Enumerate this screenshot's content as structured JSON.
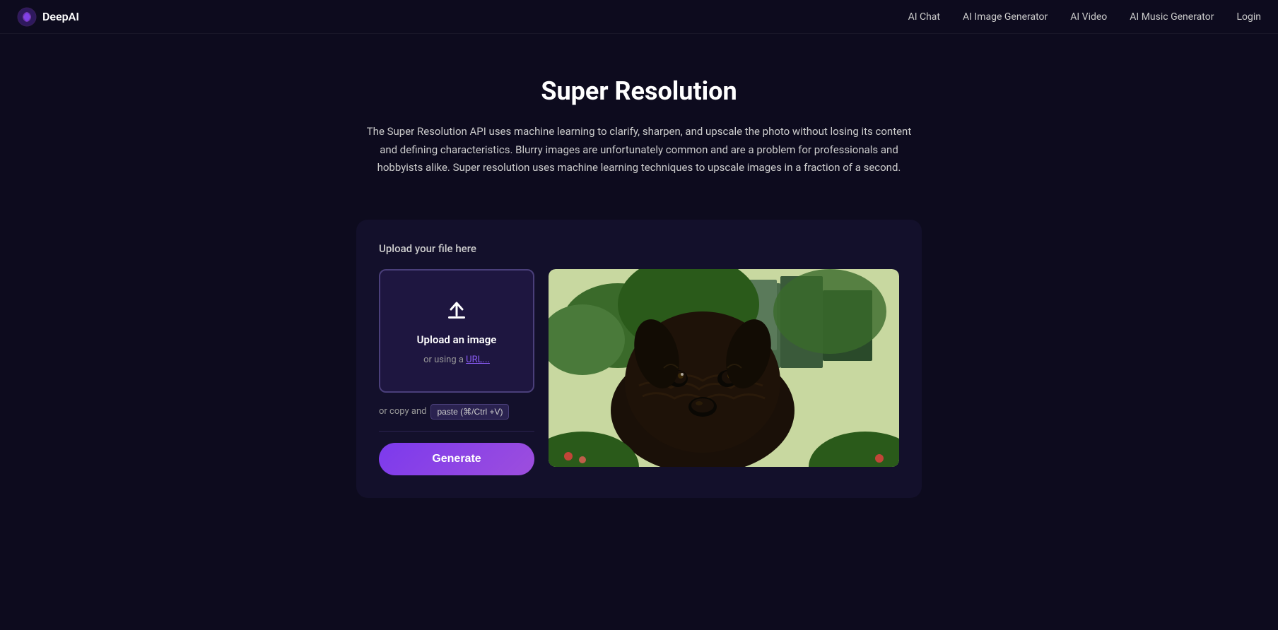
{
  "brand": {
    "name": "DeepAI",
    "logo_alt": "DeepAI Logo"
  },
  "navbar": {
    "links": [
      {
        "id": "ai-chat",
        "label": "AI Chat",
        "href": "#"
      },
      {
        "id": "ai-image-generator",
        "label": "AI Image Generator",
        "href": "#"
      },
      {
        "id": "ai-video",
        "label": "AI Video",
        "href": "#"
      },
      {
        "id": "ai-music-generator",
        "label": "AI Music Generator",
        "href": "#"
      }
    ],
    "login_label": "Login"
  },
  "hero": {
    "title": "Super Resolution",
    "description": "The Super Resolution API uses machine learning  to clarify, sharpen, and upscale the photo without losing its content and defining characteristics. Blurry images are unfortunately common and are a problem for professionals and hobbyists alike. Super resolution uses machine learning techniques to upscale images in a fraction of a second."
  },
  "upload_section": {
    "title": "Upload your file here",
    "dropzone_label": "Upload an image",
    "url_text": "or using a",
    "url_link_label": "URL...",
    "paste_prefix": "or copy and",
    "paste_button_label": "paste (⌘/Ctrl +V)",
    "generate_button_label": "Generate"
  }
}
